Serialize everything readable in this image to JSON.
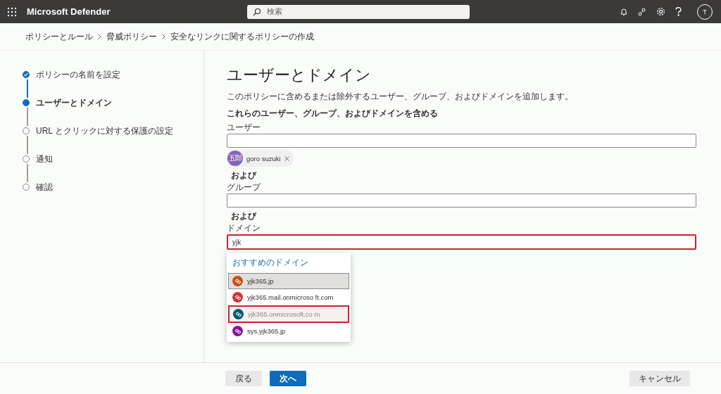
{
  "top_bar": {
    "app_title": "Microsoft Defender",
    "search": {
      "placeholder": "検索"
    },
    "account_initial": "T"
  },
  "breadcrumb": [
    "ポリシーとルール",
    "脅威ポリシー",
    "安全なリンクに関するポリシーの作成"
  ],
  "steps": [
    {
      "label": "ポリシーの名前を設定",
      "completed": true,
      "selected": false
    },
    {
      "label": "ユーザーとドメイン",
      "completed": false,
      "selected": true
    },
    {
      "label": "URL とクリックに対する保護の設定",
      "completed": false,
      "selected": false
    },
    {
      "label": "通知",
      "completed": false,
      "selected": false
    },
    {
      "label": "確認",
      "completed": false,
      "selected": false
    }
  ],
  "page": {
    "title": "ユーザーとドメイン",
    "description": "このポリシーに含めるまたは除外するユーザー、グループ、およびドメインを追加します。",
    "section_heading": "これらのユーザー、グループ、およびドメインを含める"
  },
  "fields": [
    {
      "label": "ユーザー",
      "highlighted": false,
      "chips": [
        {
          "initials": "五郎",
          "name": "goro suzuki"
        }
      ]
    },
    {
      "connector": "および",
      "label": "グループ",
      "highlighted": false
    },
    {
      "connector": "および",
      "label": "ドメイン",
      "value": "yjk",
      "highlighted": true
    }
  ],
  "suggestions": {
    "heading": "おすすめのドメイン",
    "items": [
      {
        "label": "yjk365.jp",
        "color": "#ca5010",
        "selected": true,
        "highlighted": false
      },
      {
        "label": "yjk365.mail.onmicroso ft.com",
        "color": "#d13438",
        "selected": false,
        "highlighted": false
      },
      {
        "label": "yjk365.onmicrosoft.co m",
        "color": "#005b70",
        "selected": false,
        "highlighted": true
      },
      {
        "label": "sys.yjk365.jp",
        "color": "#881798",
        "selected": false,
        "highlighted": false
      }
    ]
  },
  "footer": {
    "back": "戻る",
    "next": "次へ",
    "cancel": "キャンセル"
  }
}
